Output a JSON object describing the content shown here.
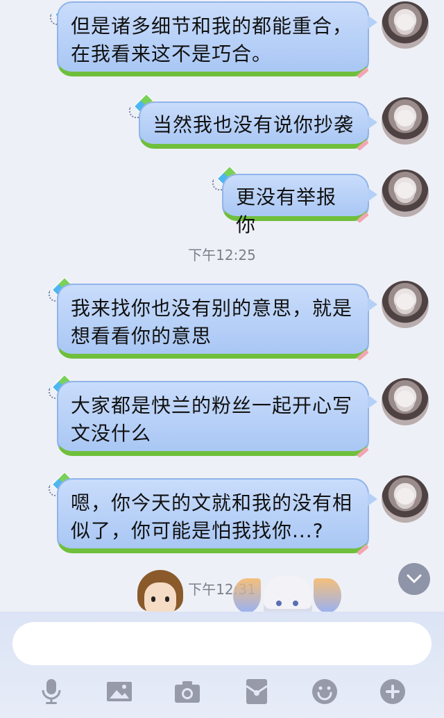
{
  "messages": [
    {
      "id": "m1",
      "side": "right",
      "text_lines": [
        "但是诸多细节和我的都能重合，",
        "在我看来这不是巧合。"
      ]
    },
    {
      "id": "m2",
      "side": "right",
      "text_lines": [
        "当然我也没有说你抄袭"
      ]
    },
    {
      "id": "m3",
      "side": "right",
      "text_lines": [
        "更没有举报你"
      ]
    },
    {
      "id": "m4",
      "side": "right",
      "text_lines": [
        "我来找你也没有别的意思，就是",
        "想看看你的意思"
      ]
    },
    {
      "id": "m5",
      "side": "right",
      "text_lines": [
        "大家都是快兰的粉丝一起开心写",
        "文没什么"
      ]
    },
    {
      "id": "m6",
      "side": "right",
      "text_lines": [
        "嗯，你今天的文就和我的没有相",
        "似了，你可能是怕我找你...?"
      ]
    }
  ],
  "timestamps": {
    "t1": "下午12:25",
    "t2": "下午12:31"
  },
  "composer": {
    "placeholder": ""
  },
  "toolbar": {
    "icons": [
      "microphone-icon",
      "image-icon",
      "camera-icon",
      "red-packet-icon",
      "emoji-icon",
      "plus-icon"
    ]
  },
  "colors": {
    "bubble": "#b5d0f6",
    "bubble_border": "#90b4ea",
    "grass": "#6fbf3c",
    "background": "#eef0f7"
  }
}
